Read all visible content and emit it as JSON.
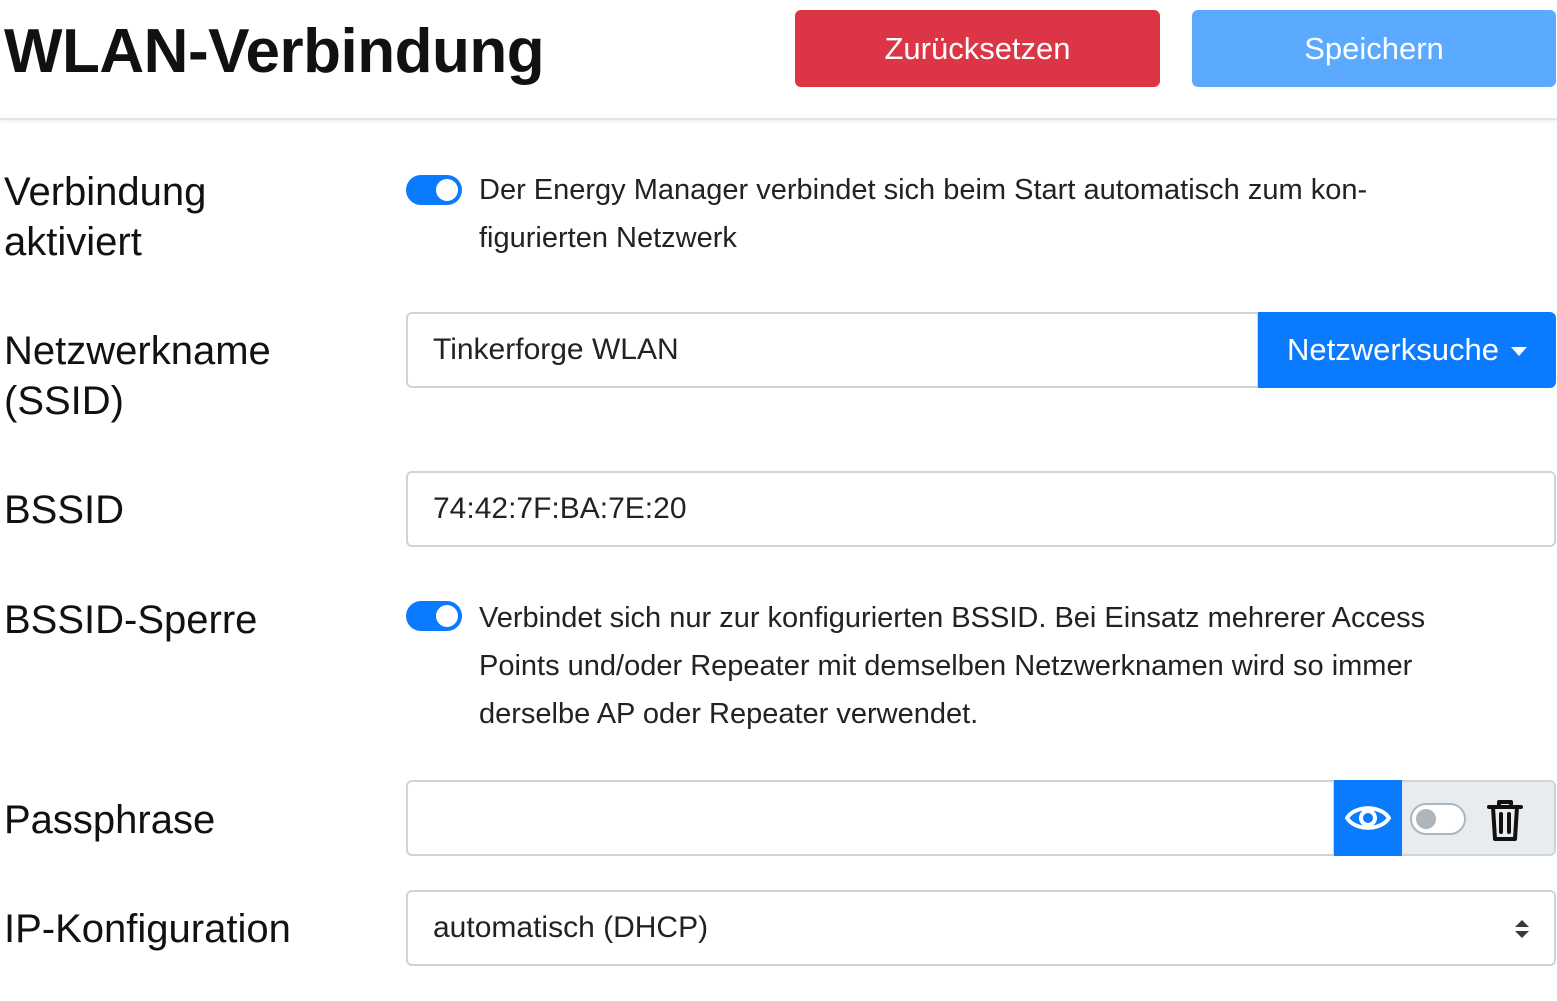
{
  "header": {
    "title": "WLAN-Verbindung",
    "reset_label": "Zurücksetzen",
    "save_label": "Speichern"
  },
  "form": {
    "connection_enabled": {
      "label_line1": "Verbindung",
      "label_line2": "aktiviert",
      "checked": true,
      "help_line1": "Der Energy Manager verbindet sich beim Start automatisch zum kon-",
      "help_line2": "figurierten Netzwerk"
    },
    "ssid": {
      "label_line1": "Netzwerkname",
      "label_line2": "(SSID)",
      "value": "Tinkerforge WLAN",
      "scan_label": "Netzwerksuche"
    },
    "bssid": {
      "label": "BSSID",
      "value": "74:42:7F:BA:7E:20"
    },
    "bssid_lock": {
      "label": "BSSID-Sperre",
      "checked": true,
      "help_line1": "Verbindet sich nur zur konfigurierten BSSID. Bei Einsatz mehrerer Access",
      "help_line2": "Points und/oder Repeater mit demselben Netzwerknamen wird so immer",
      "help_line3": "derselbe AP oder Repeater verwendet."
    },
    "passphrase": {
      "label": "Passphrase",
      "value": "",
      "show_icon": "eye-icon",
      "clear_checked": false,
      "clear_icon": "trash-icon"
    },
    "ip_config": {
      "label": "IP-Konfiguration",
      "selected": "automatisch (DHCP)"
    }
  },
  "colors": {
    "danger": "#dc3545",
    "primary": "#0a7bff",
    "primary_disabled": "#5caaff"
  }
}
